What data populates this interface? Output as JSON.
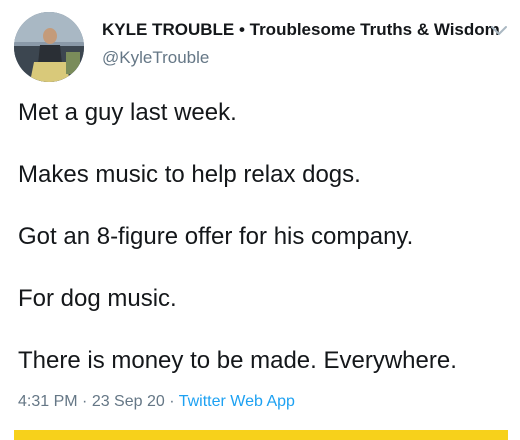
{
  "tweet": {
    "display_name": "KYLE TROUBLE • Troublesome Truths & Wisdom",
    "handle": "@KyleTrouble",
    "paragraphs": [
      "Met a guy last week.",
      "Makes music to help relax dogs.",
      "Got an 8-figure offer for his company.",
      "For dog music.",
      "There is money to be made. Everywhere."
    ],
    "time": "4:31 PM",
    "separator": " · ",
    "date": "23 Sep 20",
    "source": "Twitter Web App"
  },
  "icons": {
    "menu": "chevron-down-icon"
  },
  "colors": {
    "text": "#14171a",
    "secondary": "#657786",
    "link": "#1da1f2",
    "bar": "#f7d11b"
  }
}
